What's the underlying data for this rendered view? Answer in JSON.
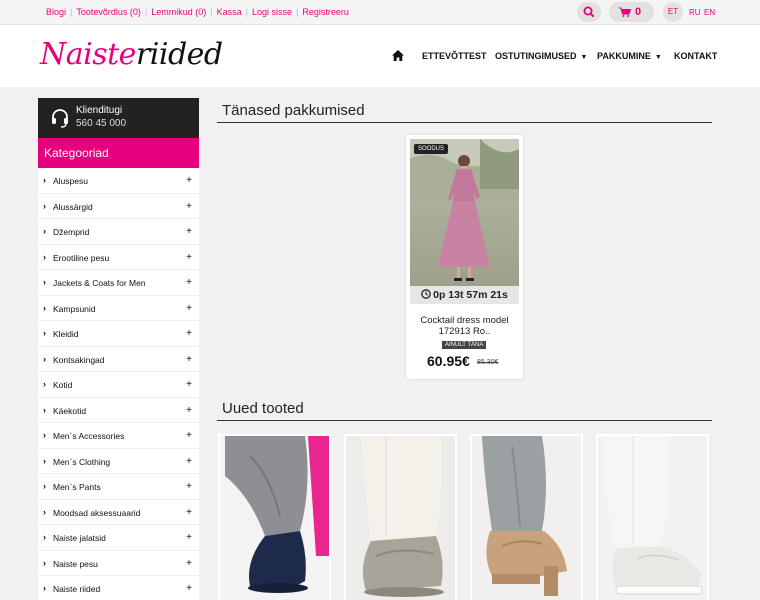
{
  "topbar": {
    "links": [
      "Blogi",
      "Tootevõrdlus (0)",
      "Lemmikud (0)",
      "Kassa",
      "Logi sisse",
      "Registreeru"
    ],
    "cart_count": "0",
    "languages": [
      "ET",
      "RU",
      "EN"
    ]
  },
  "header": {
    "logo_part1": "Naiste",
    "logo_part2": "riided",
    "nav": [
      {
        "label": "ETTEVÕTTEST"
      },
      {
        "label": "OSTUTINGIMUSED"
      },
      {
        "label": "PAKKUMINE"
      },
      {
        "label": "KONTAKT"
      }
    ]
  },
  "sidebar": {
    "support_title": "Klienditugi",
    "support_phone": "560 45 000",
    "categories_title": "Kategooriad",
    "categories": [
      "Aluspesu",
      "Alussärgid",
      "Džemprid",
      "Erootiline pesu",
      "Jackets & Coats for Men",
      "Kampsunid",
      "Kleidid",
      "Kontsakingad",
      "Kotid",
      "Käekotid",
      "Men`s Accessories",
      "Men`s Clothing",
      "Men`s Pants",
      "Moodsad aksessuaarid",
      "Naiste jalatsid",
      "Naiste pesu",
      "Naiste riided"
    ]
  },
  "main": {
    "deals_title": "Tänased pakkumised",
    "new_title": "Uued tooted",
    "deal": {
      "badge": "SOODUS",
      "timer": "0p 13t 57m 21s",
      "name": "Cocktail dress model 172913 Ro..",
      "only_today": "AINULT TÄNA",
      "price": "60.95€",
      "old_price": "85.30€"
    }
  },
  "colors": {
    "accent": "#e6007e",
    "dark": "#222222"
  }
}
